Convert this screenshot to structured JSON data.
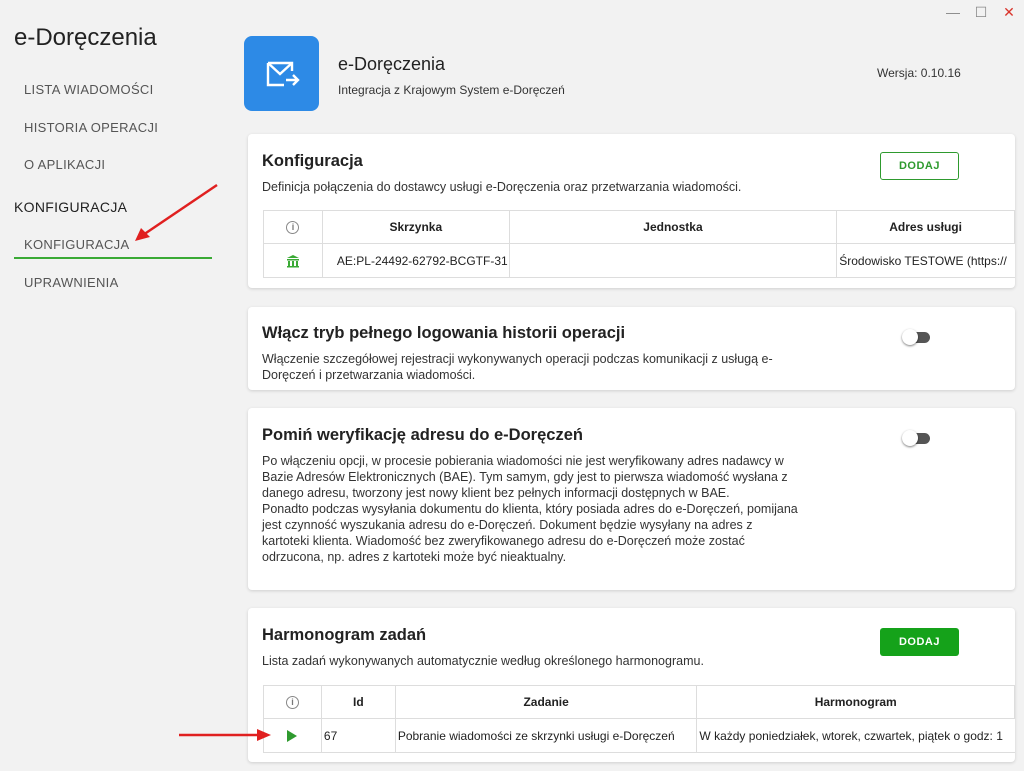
{
  "window": {
    "minimize": "—",
    "maximize": "☐",
    "close": "✕"
  },
  "app_title": "e-Doręczenia",
  "sidebar": {
    "items": [
      {
        "label": "LISTA WIADOMOŚCI"
      },
      {
        "label": "HISTORIA OPERACJI"
      },
      {
        "label": "O APLIKACJI"
      }
    ],
    "section": "KONFIGURACJA",
    "sub_items": [
      {
        "label": "KONFIGURACJA"
      },
      {
        "label": "UPRAWNIENIA"
      }
    ]
  },
  "header": {
    "title": "e-Doręczenia",
    "subtitle": "Integracja z Krajowym System e-Doręczeń",
    "version": "Wersja: 0.10.16"
  },
  "config_card": {
    "title": "Konfiguracja",
    "desc": "Definicja połączenia do dostawcy usługi e-Doręczenia oraz przetwarzania wiadomości.",
    "add_label": "DODAJ",
    "columns": [
      "ⓘ",
      "Skrzynka",
      "Jednostka",
      "Adres usługi"
    ],
    "rows": [
      {
        "skrzynka": "AE:PL-24492-62792-BCGTF-31",
        "jednostka": "",
        "adres": "Środowisko TESTOWE (https://"
      }
    ]
  },
  "logging_card": {
    "title": "Włącz tryb pełnego logowania historii operacji",
    "desc": "Włączenie szczegółowej rejestracji wykonywanych operacji podczas komunikacji z usługą e-Doręczeń i przetwarzania wiadomości.",
    "enabled": false
  },
  "verify_card": {
    "title": "Pomiń weryfikację adresu do e-Doręczeń",
    "desc1": "Po włączeniu opcji, w procesie pobierania wiadomości nie jest weryfikowany adres nadawcy w Bazie Adresów Elektronicznych (BAE). Tym samym, gdy jest to pierwsza wiadomość wysłana z danego adresu, tworzony jest nowy klient bez pełnych informacji dostępnych w BAE.",
    "desc2": "Ponadto podczas wysyłania dokumentu do klienta, który posiada adres do e-Doręczeń, pomijana jest czynność wyszukania adresu do e-Doręczeń. Dokument będzie wysyłany na adres z kartoteki klienta. Wiadomość bez zweryfikowanego adresu do e-Doręczeń może zostać odrzucona, np. adres z kartoteki może być nieaktualny.",
    "enabled": false
  },
  "schedule_card": {
    "title": "Harmonogram zadań",
    "desc": "Lista zadań wykonywanych automatycznie według określonego harmonogramu.",
    "add_label": "DODAJ",
    "columns": [
      "ⓘ",
      "Id",
      "Zadanie",
      "Harmonogram"
    ],
    "rows": [
      {
        "id": "67",
        "zadanie": "Pobranie wiadomości ze skrzynki usługi e-Doręczeń",
        "harmonogram": "W każdy poniedziałek, wtorek, czwartek, piątek o godz: 1"
      }
    ]
  },
  "colors": {
    "accent": "#15a21a",
    "logo": "#2d8ae6",
    "annotation": "#e02020"
  }
}
